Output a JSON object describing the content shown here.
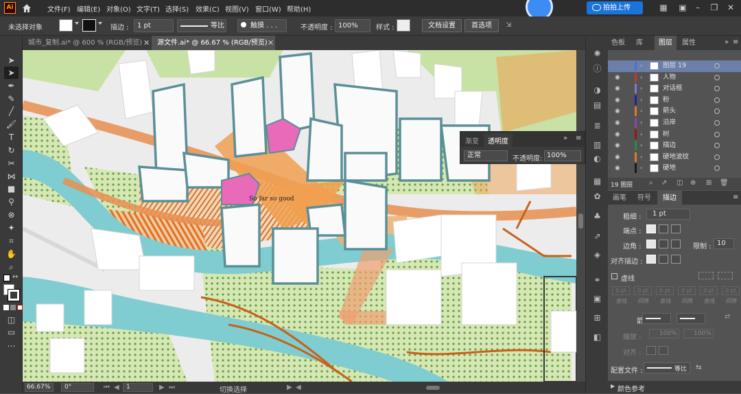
{
  "app": {
    "logo": "Ai",
    "upload_label": "拍拍上传"
  },
  "menu": [
    "文件(F)",
    "编辑(E)",
    "对象(O)",
    "文字(T)",
    "选择(S)",
    "效果(C)",
    "视图(V)",
    "窗口(W)",
    "帮助(H)"
  ],
  "control": {
    "selection": "未选择对象",
    "stroke_label": "描边 :",
    "stroke_value": "1 pt",
    "profile_label": "等比",
    "brush_label": "触摸 . . .",
    "opacity_label": "不透明度 :",
    "opacity_value": "100%",
    "style_label": "样式 :",
    "doc_setup": "文档设置",
    "preferences": "首选项"
  },
  "tabs": [
    {
      "label": "城市_复制.ai* @ 600 % (RGB/预览)",
      "active": false
    },
    {
      "label": "源文件.ai* @ 66.67 % (RGB/预览)",
      "active": true
    }
  ],
  "canvas": {
    "annotation": "So far so good"
  },
  "transparency_panel": {
    "tab1": "渐变",
    "tab2": "透明度",
    "blend_mode": "正常",
    "opacity_label": "不透明度:",
    "opacity_value": "100%"
  },
  "status": {
    "zoom": "66.67%",
    "angle": "0°",
    "page": "1",
    "tool_label": "切换选择"
  },
  "layers_panel": {
    "tabs": [
      "色板",
      "库",
      "图层",
      "属性"
    ],
    "active_tab": "图层",
    "layers": [
      {
        "name": "图层 19",
        "color": "#4a6fd8"
      },
      {
        "name": "人物",
        "color": "#c0392b"
      },
      {
        "name": "对话框",
        "color": "#7b7bd8"
      },
      {
        "name": "粉",
        "color": "#1f1fa8"
      },
      {
        "name": "箭头",
        "color": "#e07b20"
      },
      {
        "name": "沿岸",
        "color": "#8e44ad"
      },
      {
        "name": "树",
        "color": "#8b1a1a"
      },
      {
        "name": "描边",
        "color": "#2e8b3e"
      },
      {
        "name": "硬地波纹",
        "color": "#e07b20"
      },
      {
        "name": "硬地",
        "color": "#1a1a1a"
      }
    ],
    "count_label": "19 图层"
  },
  "stroke_panel": {
    "tabs": [
      "画笔",
      "符号",
      "描边"
    ],
    "weight_label": "粗细 :",
    "weight_value": "1 pt",
    "cap_label": "端点 :",
    "corner_label": "边角 :",
    "limit_label": "限制 :",
    "limit_value": "10",
    "align_label": "对齐描边 :",
    "dashed_label": "虚线",
    "dash_cells": [
      "虚线",
      "间隙",
      "虚线",
      "间隙",
      "虚线",
      "间隙"
    ],
    "dash_value": "0 pt",
    "arrow_label": "箭头 :",
    "scale_label": "缩放 :",
    "scale_value": "100%",
    "align2_label": "对齐 :",
    "profile_label": "配置文件 :",
    "profile_value": "等比"
  },
  "color_guide": {
    "label": "颜色参考"
  },
  "colors": {
    "accent": "#1b74d9",
    "pink": "#e86ab8",
    "teal": "#5a8f98",
    "river": "#7ec8cc",
    "road": "#e8935a",
    "grass": "#c5e0a0"
  }
}
